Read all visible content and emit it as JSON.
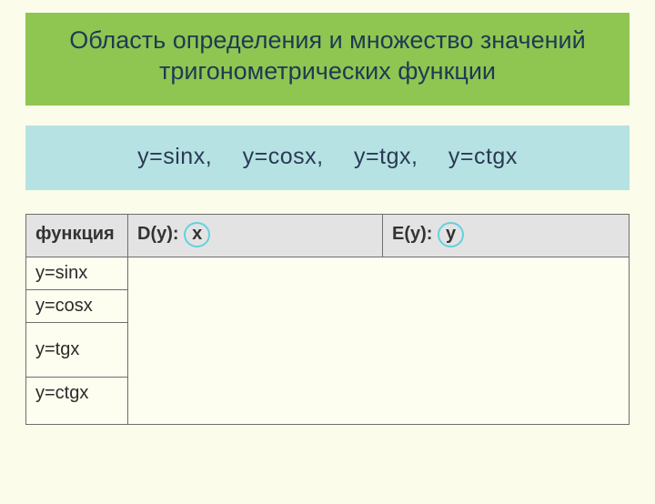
{
  "header": {
    "title": "Область определения и множество значений тригонометрических функции"
  },
  "functions_band": {
    "items": [
      "y=sinx,",
      "y=cosx,",
      "y=tgx,",
      "y=ctgx"
    ]
  },
  "table": {
    "headers": {
      "func": "функция",
      "domain_prefix": "D(y): ",
      "domain_var": "x",
      "range_prefix": "E(y): ",
      "range_var": "y"
    },
    "rows": [
      {
        "func": "y=sinx"
      },
      {
        "func": "y=cosx"
      },
      {
        "func": "y=tgx"
      },
      {
        "func": "y=ctgx"
      }
    ]
  }
}
